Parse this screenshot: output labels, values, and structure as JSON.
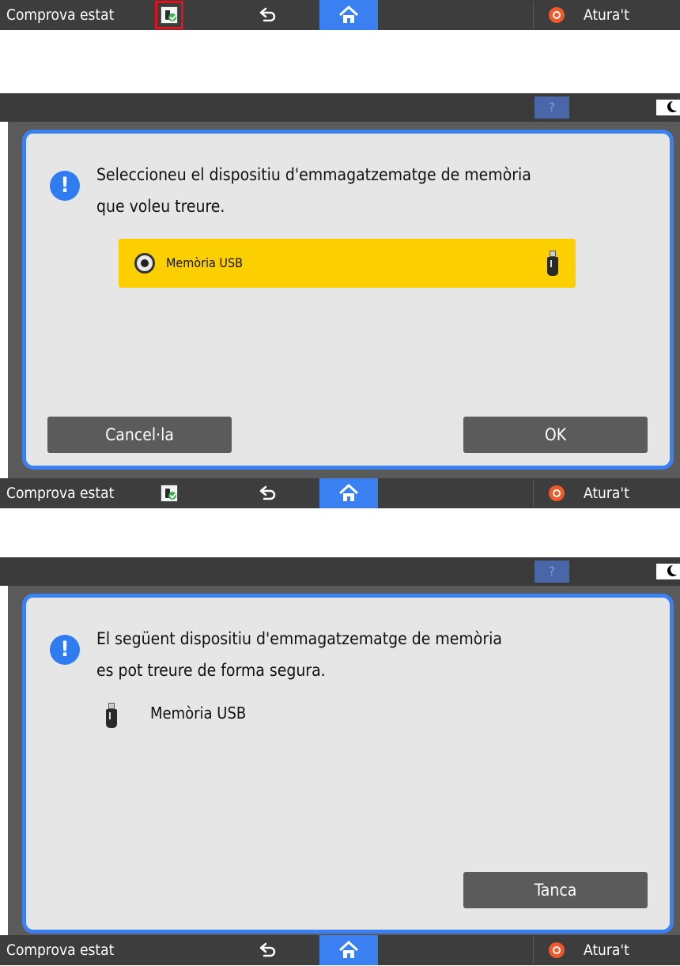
{
  "status_bar": {
    "check_status_label": "Comprova estat",
    "stop_label": "Atura't",
    "home_color": "#3a80f0"
  },
  "help_label": "?",
  "dialog1": {
    "message_line1": "Seleccioneu el dispositiu d'emmagatzematge de memòria",
    "message_line2": "que voleu treure.",
    "device_label": "Memòria USB",
    "cancel_label": "Cancel·la",
    "ok_label": "OK"
  },
  "dialog2": {
    "message_line1": "El següent dispositiu d'emmagatzematge de memòria",
    "message_line2": "es pot treure de forma segura.",
    "device_label": "Memòria USB",
    "close_label": "Tanca"
  },
  "icons": [
    "usb-status-icon",
    "back-arrow-icon",
    "home-icon",
    "stop-icon",
    "help-icon",
    "moon-icon",
    "exclamation-icon",
    "usb-stick-icon",
    "radio-selected-icon"
  ],
  "colors": {
    "accent": "#3a80f0",
    "selected_row": "#fbcf00",
    "highlight": "#e0131d",
    "stop": "#f05a2a"
  }
}
